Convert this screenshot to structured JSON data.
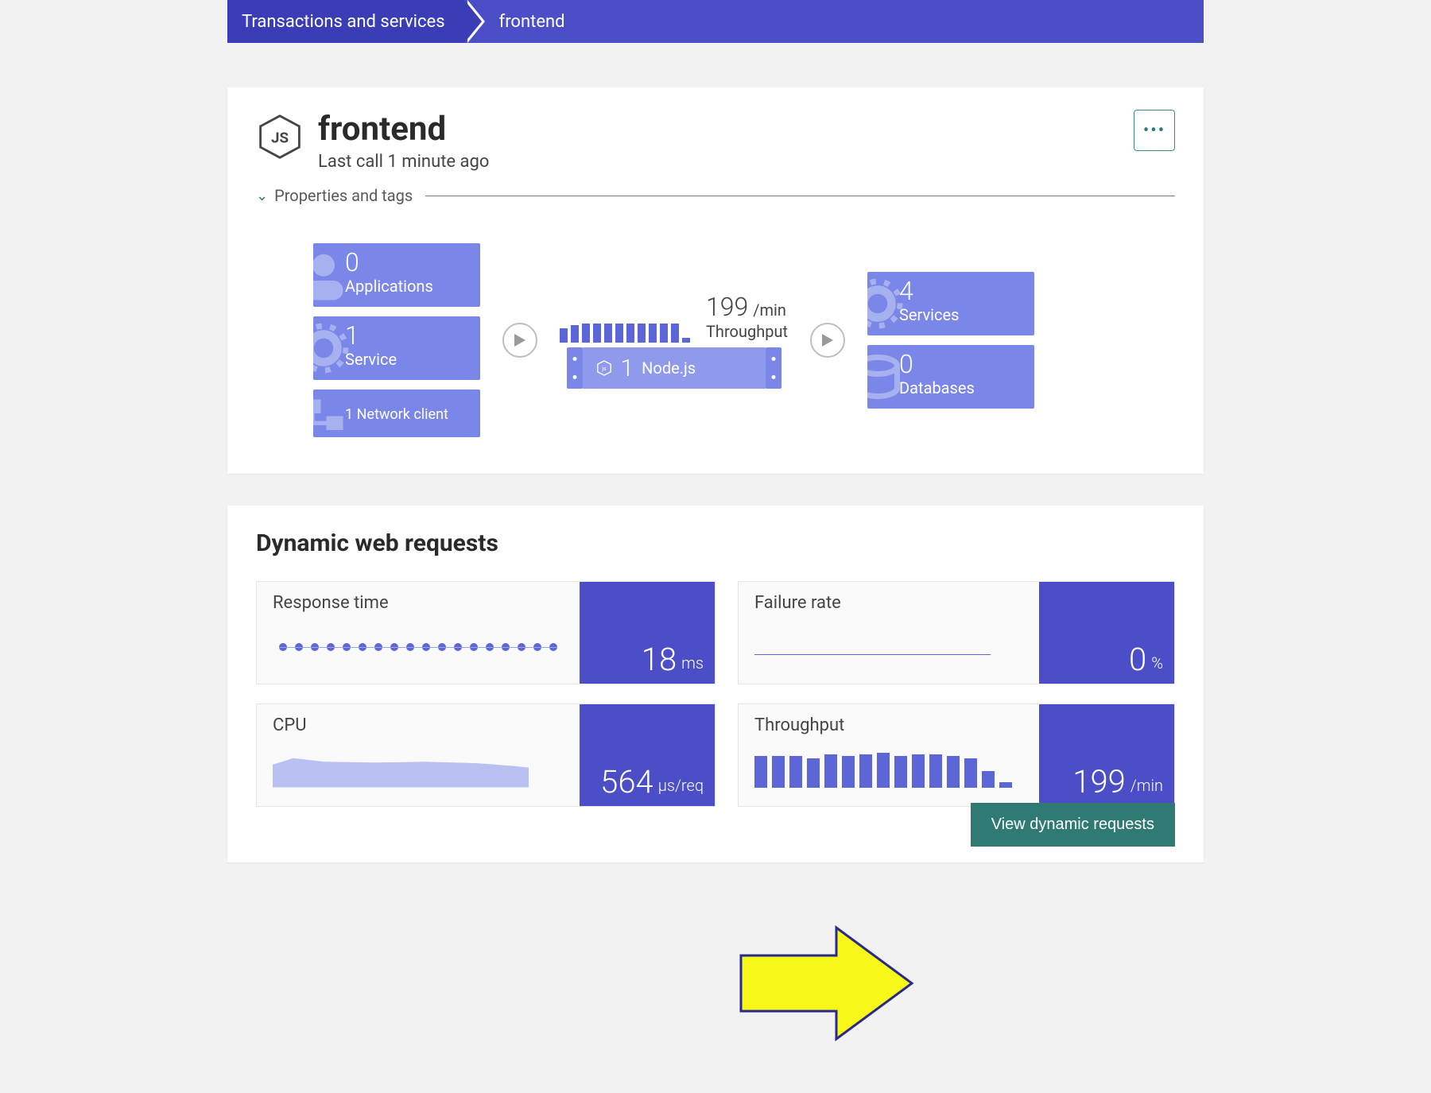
{
  "breadcrumb": {
    "root": "Transactions and services",
    "current": "frontend"
  },
  "header": {
    "title": "frontend",
    "subtitle": "Last call 1 minute ago",
    "properties_toggle": "Properties and tags",
    "icon": "nodejs-icon"
  },
  "flow": {
    "left_tiles": [
      {
        "value": "0",
        "label": "Applications",
        "icon": "user-icon"
      },
      {
        "value": "1",
        "label": "Service",
        "icon": "gear-icon"
      },
      {
        "value": "1",
        "label": "Network client",
        "icon": "network-icon",
        "compact": true
      }
    ],
    "center": {
      "throughput_value": "199",
      "throughput_unit": "/min",
      "throughput_label": "Throughput",
      "node_count": "1",
      "node_label": "Node.js"
    },
    "right_tiles": [
      {
        "value": "4",
        "label": "Services",
        "icon": "gear-icon"
      },
      {
        "value": "0",
        "label": "Databases",
        "icon": "database-icon"
      }
    ]
  },
  "requests": {
    "heading": "Dynamic web requests",
    "metrics": [
      {
        "key": "response_time",
        "title": "Response time",
        "value": "18",
        "unit": "ms",
        "graph": "dots"
      },
      {
        "key": "failure_rate",
        "title": "Failure rate",
        "value": "0",
        "unit": "%",
        "graph": "flat"
      },
      {
        "key": "cpu",
        "title": "CPU",
        "value": "564",
        "unit": "µs/req",
        "graph": "area"
      },
      {
        "key": "throughput",
        "title": "Throughput",
        "value": "199",
        "unit": "/min",
        "graph": "bars"
      }
    ],
    "button": "View dynamic requests"
  },
  "chart_data": [
    {
      "type": "bar",
      "owner": "flow.spark",
      "values": [
        18,
        22,
        24,
        24,
        24,
        24,
        24,
        24,
        24,
        24,
        24,
        6
      ],
      "ylim": [
        0,
        26
      ]
    },
    {
      "type": "line",
      "owner": "metric.response_time",
      "values": [
        18,
        18,
        18,
        18,
        18,
        18,
        18,
        18,
        18,
        18,
        18,
        18,
        18,
        18,
        18,
        18,
        18,
        18
      ],
      "ylabel": "ms",
      "ylim": [
        0,
        30
      ],
      "style": "dots"
    },
    {
      "type": "line",
      "owner": "metric.failure_rate",
      "values": [
        0,
        0
      ],
      "ylabel": "%",
      "ylim": [
        0,
        100
      ]
    },
    {
      "type": "area",
      "owner": "metric.cpu",
      "values": [
        560,
        600,
        570,
        565,
        570,
        562,
        555,
        540
      ],
      "ylabel": "µs/req",
      "ylim": [
        0,
        800
      ]
    },
    {
      "type": "bar",
      "owner": "metric.throughput",
      "values": [
        42,
        42,
        42,
        40,
        44,
        42,
        44,
        46,
        42,
        44,
        44,
        42,
        40,
        22,
        8
      ],
      "ylabel": "/min",
      "ylim": [
        0,
        50
      ]
    }
  ],
  "colors": {
    "brand": "#4c4ec7",
    "tile": "#7a87e8",
    "accent_teal": "#2f7a72"
  }
}
